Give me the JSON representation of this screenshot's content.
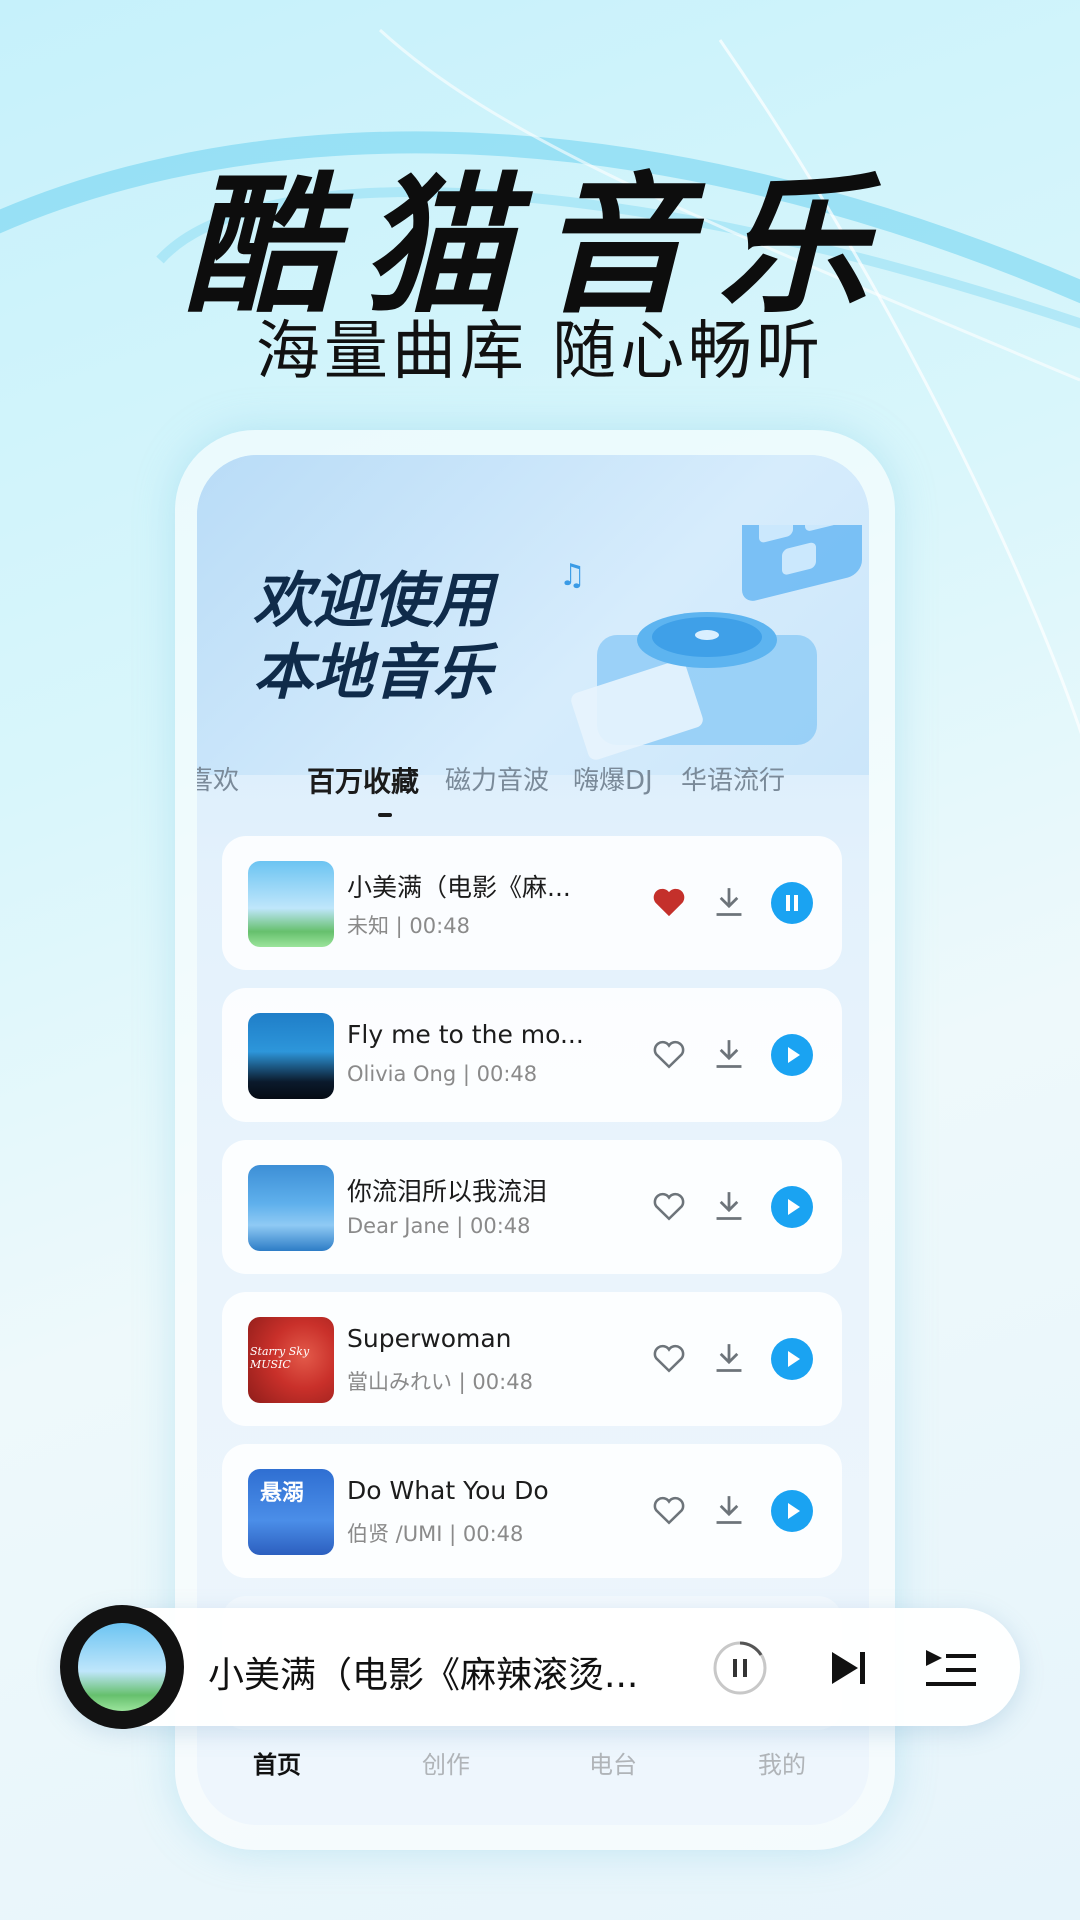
{
  "headline": "酷猫音乐",
  "subline": "海量曲库 随心畅听",
  "banner": {
    "line1": "欢迎使用",
    "line2": "本地音乐"
  },
  "tabs": [
    "喜欢",
    "百万收藏",
    "磁力音波",
    "嗨爆DJ",
    "华语流行"
  ],
  "active_tab": "百万收藏",
  "songs": [
    {
      "title": "小美满（电影《麻...",
      "sub": "未知 | 00:48",
      "liked": true,
      "playing": true
    },
    {
      "title": "Fly me to the mo...",
      "sub": "Olivia Ong | 00:48",
      "liked": false,
      "playing": false
    },
    {
      "title": "你流泪所以我流泪",
      "sub": "Dear Jane | 00:48",
      "liked": false,
      "playing": false
    },
    {
      "title": "Superwoman",
      "sub": "當山みれい | 00:48",
      "liked": false,
      "playing": false
    },
    {
      "title": "Do What You Do",
      "sub": "伯贤 /UMI | 00:48",
      "liked": false,
      "playing": false
    }
  ],
  "nav": [
    "首页",
    "创作",
    "电台",
    "我的"
  ],
  "active_nav": "首页",
  "player": {
    "title": "小美满（电影《麻辣滚烫..."
  },
  "colors": {
    "accent": "#1aa3f2",
    "heart": "#c4302b"
  },
  "cover_labels": {
    "song4": "Starry Sky MUSIC",
    "song5": "悬溺"
  }
}
